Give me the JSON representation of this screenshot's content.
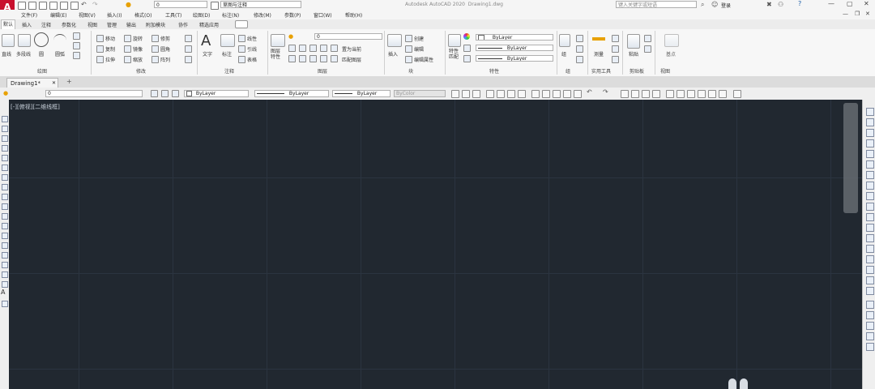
{
  "window": {
    "title": "Autodesk AutoCAD 2020",
    "filename": "Drawing1.dwg",
    "search_placeholder": "键入关键字或短语",
    "login_label": "登录",
    "help_label": "?"
  },
  "quick_access": {
    "layer_value": "0",
    "workspace_value": "草图与注释"
  },
  "menu": [
    "文件(F)",
    "编辑(E)",
    "视图(V)",
    "插入(I)",
    "格式(O)",
    "工具(T)",
    "绘图(D)",
    "标注(N)",
    "修改(M)",
    "参数(P)",
    "窗口(W)",
    "帮助(H)"
  ],
  "ribbon_tabs": [
    "默认",
    "插入",
    "注释",
    "参数化",
    "视图",
    "管理",
    "输出",
    "附加模块",
    "协作",
    "精选应用"
  ],
  "ribbon": {
    "draw": {
      "title": "绘图",
      "line": "直线",
      "polyline": "多段线",
      "circle": "圆",
      "arc": "圆弧"
    },
    "modify": {
      "title": "修改",
      "move": "移动",
      "rotate": "旋转",
      "trim": "修剪",
      "copy": "复制",
      "mirror": "镜像",
      "fillet": "圆角",
      "stretch": "拉伸",
      "scale": "缩放",
      "array": "阵列"
    },
    "annotation": {
      "title": "注释",
      "text": "文字",
      "dimension": "标注",
      "linear": "线性",
      "leader": "引线",
      "table": "表格"
    },
    "layers": {
      "title": "图层",
      "layer_properties": "图层\n特性",
      "layer_value": "0",
      "make_current": "置为当前",
      "match_layer": "匹配图层"
    },
    "block": {
      "title": "块",
      "insert": "插入",
      "create": "创建",
      "edit": "编辑",
      "edit_attributes": "编辑属性"
    },
    "properties": {
      "title": "特性",
      "match": "特性\n匹配",
      "color": "ByLayer",
      "linetype": "ByLayer",
      "lineweight": "ByLayer"
    },
    "groups": {
      "title": "组",
      "group": "组"
    },
    "utilities": {
      "title": "实用工具",
      "measure": "测量"
    },
    "clipboard": {
      "title": "剪贴板",
      "paste": "粘贴"
    },
    "view": {
      "title": "视图",
      "base": "基点"
    }
  },
  "doc_tabs": {
    "active": "Drawing1*",
    "add": "+"
  },
  "properties_toolbar": {
    "layer": "0",
    "color": "ByLayer",
    "linetype": "ByLayer",
    "lineweight": "ByLayer",
    "plotstyle": "ByColor"
  },
  "viewport": {
    "label": "[-][俯视][二维线框]"
  },
  "colors": {
    "canvas_bg": "#212830",
    "grid_line": "#2b3440",
    "app_icon": "#c8102e"
  }
}
